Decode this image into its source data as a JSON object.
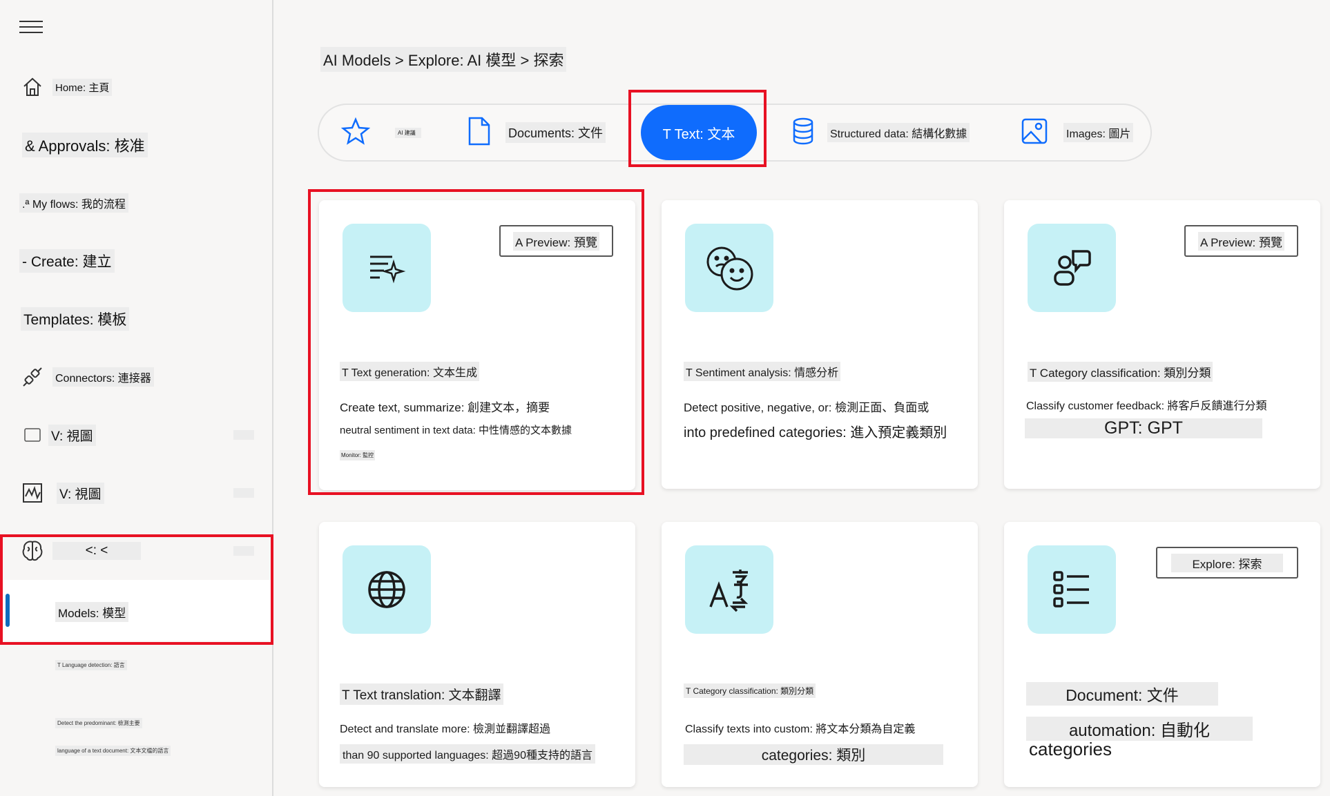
{
  "sidebar": {
    "items": [
      {
        "label": "Home: 主頁"
      },
      {
        "label": "& Approvals: 核准"
      },
      {
        "label": ".ª My flows: 我的流程"
      },
      {
        "label": "- Create: 建立"
      },
      {
        "label": "Templates: 模板"
      },
      {
        "label": "Connectors: 連接器"
      },
      {
        "label": "V: 視圖"
      },
      {
        "label": "V: 視圖"
      },
      {
        "label": "<: <"
      },
      {
        "label": "Models: 模型"
      }
    ],
    "extra_1": "T Language detection: 語言",
    "extra_2": "Detect the predominant: 檢測主要",
    "extra_3": "language of a text document: 文本文檔的語言"
  },
  "breadcrumb": "AI Models > Explore: AI 模型 > 探索",
  "tabs": [
    {
      "label": "AI 建議"
    },
    {
      "label": "Documents: 文件"
    },
    {
      "label": "T Text: 文本"
    },
    {
      "label": "Structured data: 結構化數據"
    },
    {
      "label": "Images: 圖片"
    }
  ],
  "cards": [
    {
      "title": "T Text generation: 文本生成",
      "desc1": "Create text, summarize: 創建文本，摘要",
      "desc2": "neutral sentiment in text data: 中性情感的文本數據",
      "extra": "Monitor: 監控",
      "badge": "A Preview: 預覽",
      "icon": "text-sparkle-icon"
    },
    {
      "title": "T Sentiment analysis: 情感分析",
      "desc1": "Detect positive, negative, or: 檢測正面、負面或",
      "desc2": "into predefined categories: 進入預定義類別",
      "badge": "",
      "icon": "emoji-faces-icon"
    },
    {
      "title": "T Category classification: 類別分類",
      "desc1": "Classify customer feedback: 將客戶反饋進行分類",
      "desc2": "GPT: GPT",
      "badge": "A Preview: 預覽",
      "icon": "person-chat-icon"
    },
    {
      "title": "T Text translation: 文本翻譯",
      "desc1": "Detect and translate more: 檢測並翻譯超過",
      "desc2": "than 90 supported languages: 超過90種支持的語言",
      "badge": "",
      "icon": "globe-icon"
    },
    {
      "title": "T Category classification: 類別分類",
      "desc1": "Classify texts into custom: 將文本分類為自定義",
      "desc2": "categories: 類別",
      "badge": "",
      "icon": "translate-icon"
    },
    {
      "title": "Document: 文件",
      "desc1": "automation: 自動化",
      "desc2": "categories",
      "badge": "Explore: 探索",
      "icon": "list-icon"
    }
  ],
  "colors": {
    "accent": "#0f6cfd",
    "highlight": "#e81123",
    "icon_bg": "#c6f1f6"
  }
}
